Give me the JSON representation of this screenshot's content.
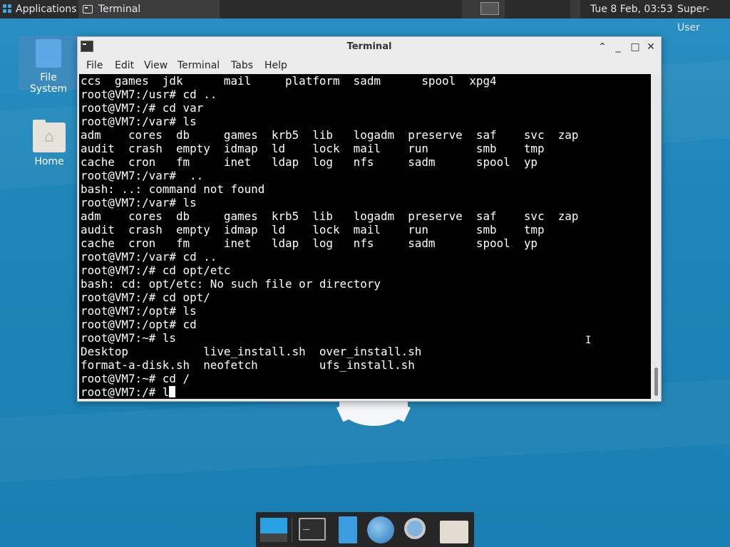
{
  "panel": {
    "apps_label": "Applications",
    "task_label": "Terminal",
    "clock": "Tue  8 Feb, 03:53",
    "user": "Super-User"
  },
  "desktop": {
    "icons": [
      {
        "label": "File System"
      },
      {
        "label": "Home"
      }
    ]
  },
  "window": {
    "title": "Terminal",
    "menu": [
      "File",
      "Edit",
      "View",
      "Terminal",
      "Tabs",
      "Help"
    ],
    "lines": [
      "ccs  games  jdk      mail     platform  sadm      spool  xpg4",
      "root@VM7:/usr# cd ..",
      "root@VM7:/# cd var",
      "root@VM7:/var# ls",
      "adm    cores  db     games  krb5  lib   logadm  preserve  saf    svc  zap",
      "audit  crash  empty  idmap  ld    lock  mail    run       smb    tmp",
      "cache  cron   fm     inet   ldap  log   nfs     sadm      spool  yp",
      "root@VM7:/var#  ..",
      "bash: ..: command not found",
      "root@VM7:/var# ls",
      "adm    cores  db     games  krb5  lib   logadm  preserve  saf    svc  zap",
      "audit  crash  empty  idmap  ld    lock  mail    run       smb    tmp",
      "cache  cron   fm     inet   ldap  log   nfs     sadm      spool  yp",
      "root@VM7:/var# cd ..",
      "root@VM7:/# cd opt/etc",
      "bash: cd: opt/etc: No such file or directory",
      "root@VM7:/# cd opt/",
      "root@VM7:/opt# ls",
      "root@VM7:/opt# cd",
      "root@VM7:~# ls",
      "Desktop           live_install.sh  over_install.sh",
      "format-a-disk.sh  neofetch         ufs_install.sh",
      "root@VM7:~# cd /"
    ],
    "prompt_line": "root@VM7:/# l"
  },
  "dock": {
    "items": [
      "show-desktop",
      "terminal",
      "file-manager",
      "web-browser",
      "app-finder",
      "folder"
    ]
  }
}
